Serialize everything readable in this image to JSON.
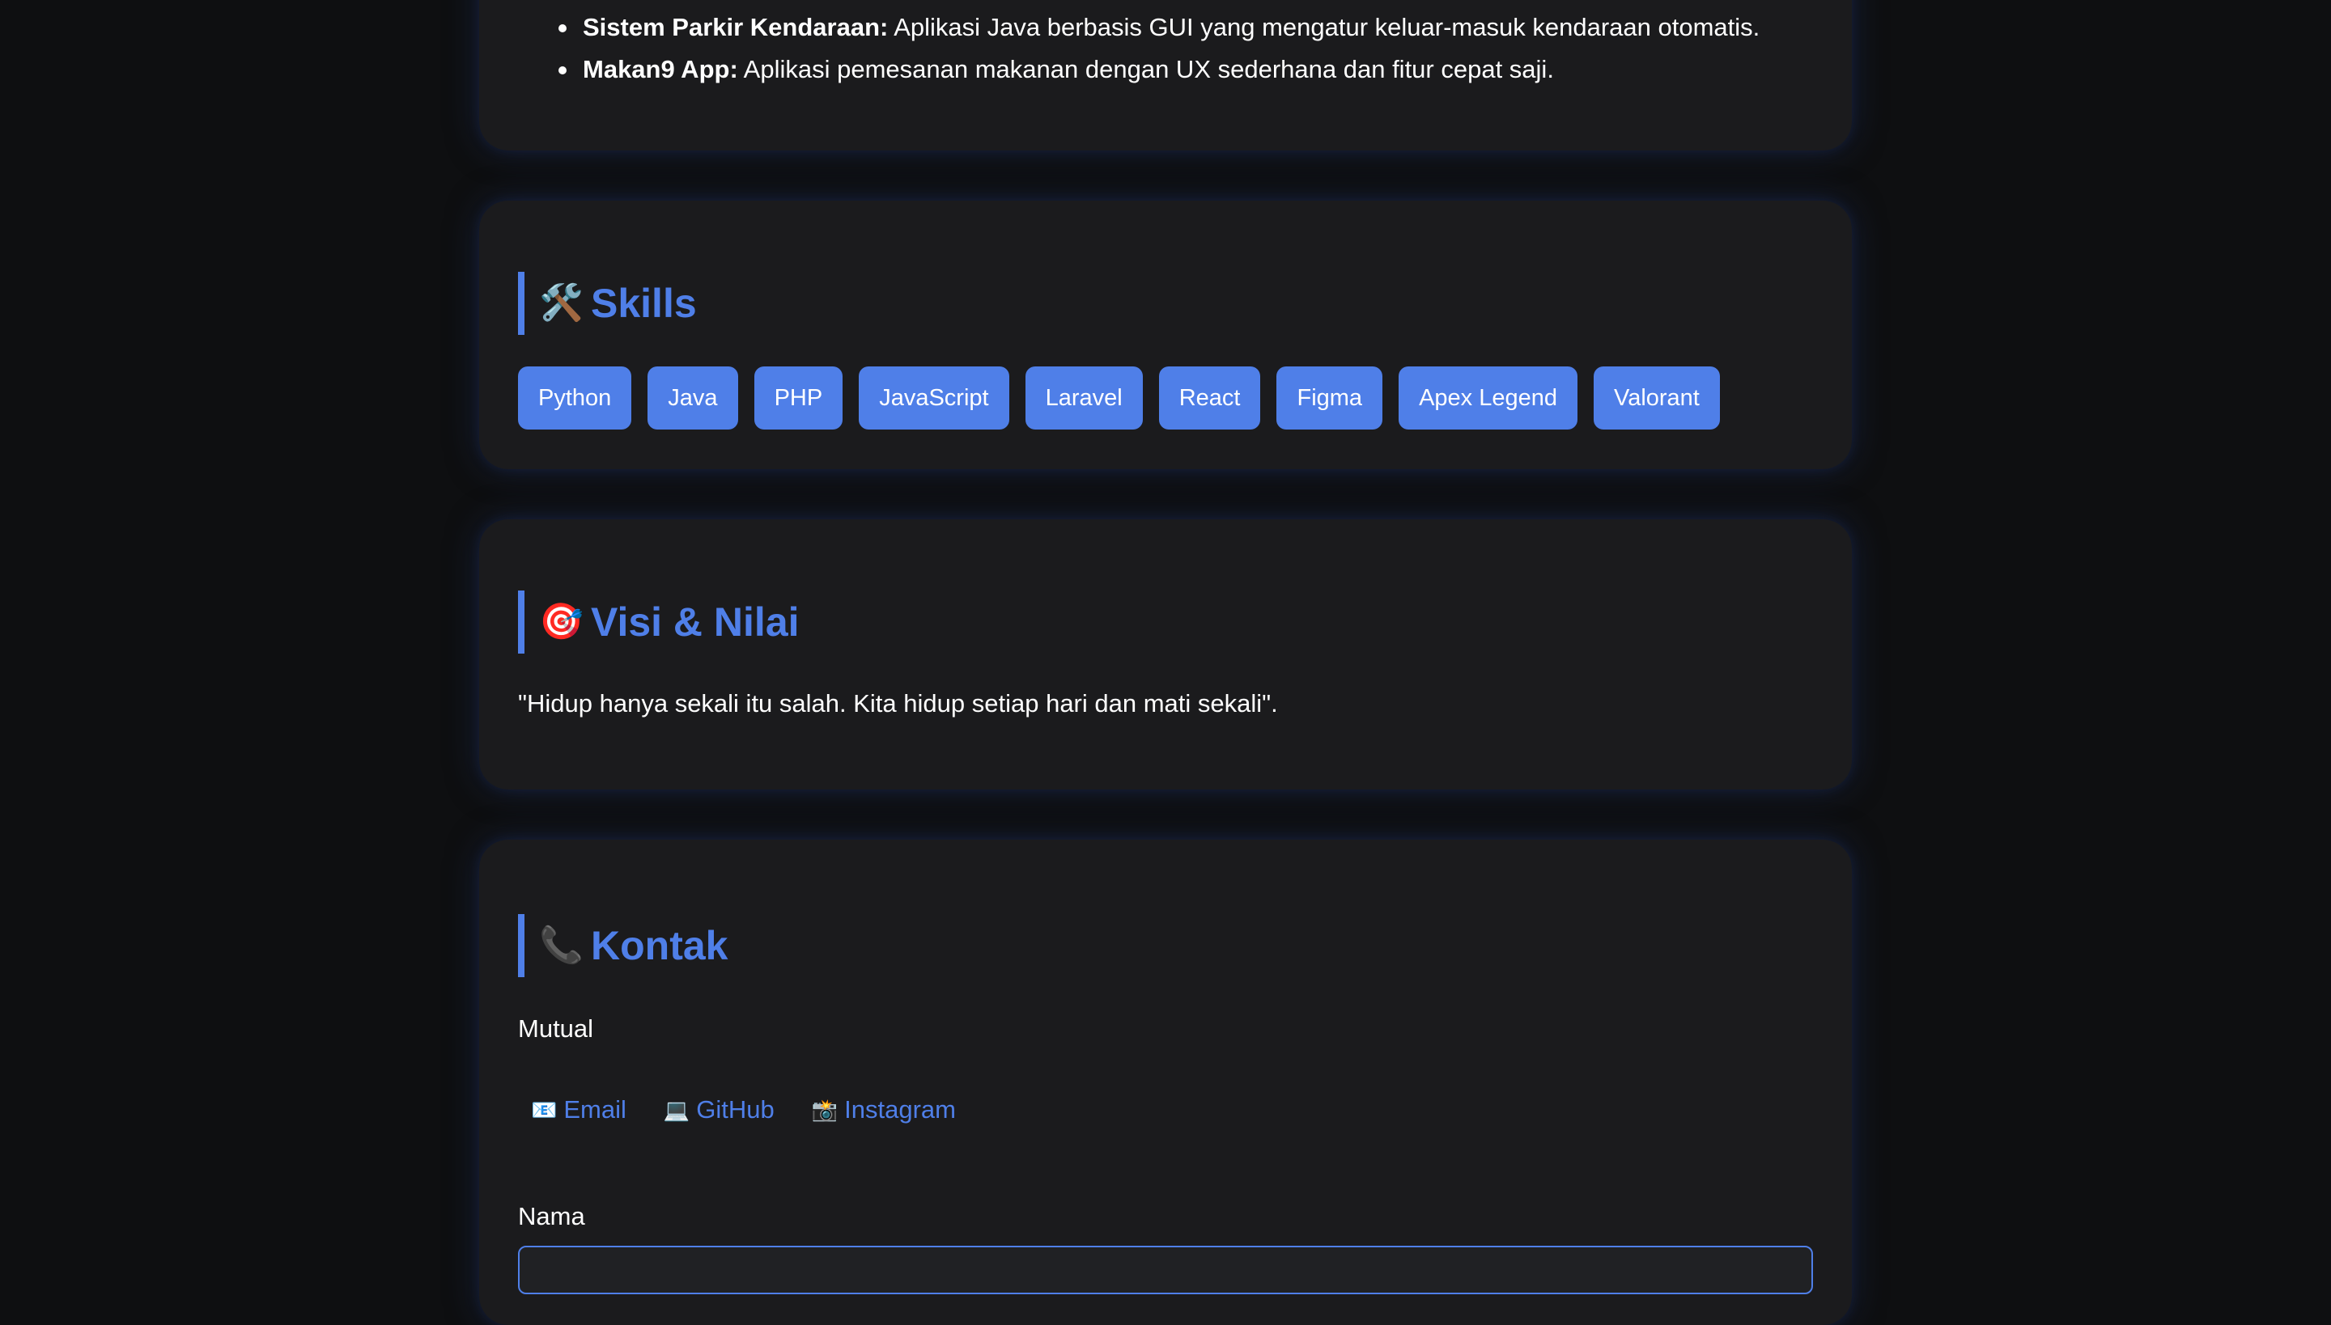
{
  "projects": {
    "items": [
      {
        "name": "Sistem Parkir Kendaraan:",
        "desc": " Aplikasi Java berbasis GUI yang mengatur keluar-masuk kendaraan otomatis."
      },
      {
        "name": "Makan9 App:",
        "desc": " Aplikasi pemesanan makanan dengan UX sederhana dan fitur cepat saji."
      }
    ]
  },
  "skills": {
    "icon": "🛠️",
    "title": "Skills",
    "tags": [
      "Python",
      "Java",
      "PHP",
      "JavaScript",
      "Laravel",
      "React",
      "Figma",
      "Apex Legend",
      "Valorant"
    ]
  },
  "visi": {
    "icon": "🎯",
    "title": "Visi & Nilai",
    "quote": "\"Hidup hanya sekali itu salah. Kita hidup setiap hari dan mati sekali\"."
  },
  "kontak": {
    "icon": "📞",
    "title": "Kontak",
    "mutual_label": "Mutual",
    "links": [
      {
        "icon": "📧",
        "label": "Email"
      },
      {
        "icon": "💻",
        "label": "GitHub"
      },
      {
        "icon": "📸",
        "label": "Instagram"
      }
    ],
    "nama_label": "Nama",
    "nama_value": ""
  },
  "colors": {
    "accent": "#4f7fe8",
    "background": "#0e0f11",
    "card": "#1b1b1d",
    "text": "#ffffff"
  }
}
